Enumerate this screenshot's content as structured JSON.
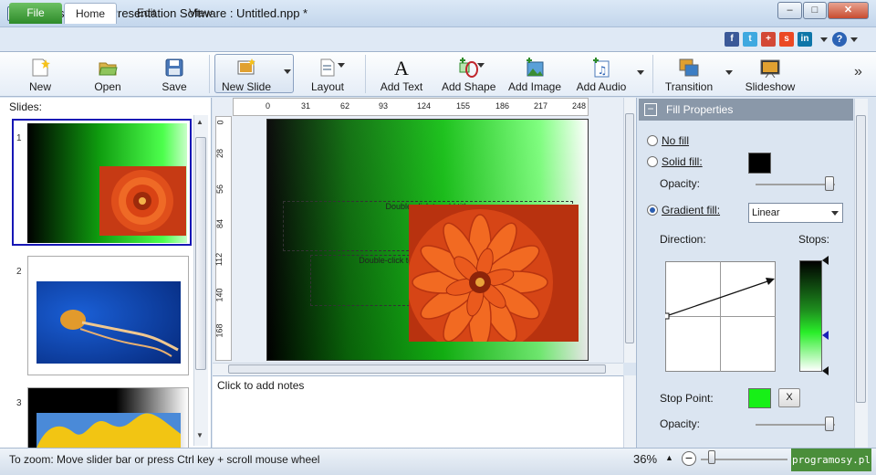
{
  "window": {
    "title": "Express Points Presentation Software : Untitled.npp *",
    "minimize": "–",
    "maximize": "□",
    "close": "✕"
  },
  "tabs": {
    "file": "File",
    "home": "Home",
    "edit": "Edit",
    "view": "View"
  },
  "toolbar": {
    "new": "New",
    "open": "Open",
    "save": "Save",
    "new_slide": "New Slide",
    "layout": "Layout",
    "add_text": "Add Text",
    "add_shape": "Add Shape",
    "add_image": "Add Image",
    "add_audio": "Add Audio",
    "transition": "Transition",
    "slideshow": "Slideshow",
    "more": "»"
  },
  "slides_panel": {
    "label": "Slides:",
    "slides": [
      {
        "num": "1"
      },
      {
        "num": "2"
      },
      {
        "num": "3"
      }
    ]
  },
  "ruler": {
    "h": [
      "0",
      "31",
      "62",
      "93",
      "124",
      "155",
      "186",
      "217",
      "248"
    ],
    "v": [
      "0",
      "28",
      "56",
      "84",
      "112",
      "140",
      "168"
    ]
  },
  "slide": {
    "placeholder1": "Double-click to add title",
    "placeholder2": "Double-click to add text"
  },
  "notes": {
    "placeholder": "Click to add notes"
  },
  "fill_properties": {
    "title": "Fill Properties",
    "collapse": "−",
    "no_fill": "No fill",
    "solid_fill": "Solid fill:",
    "opacity": "Opacity:",
    "gradient_fill": "Gradient fill:",
    "gradient_type": "Linear",
    "direction": "Direction:",
    "stops": "Stops:",
    "stop_point": "Stop Point:",
    "stop_remove": "X",
    "opacity2": "Opacity:",
    "selected": "gradient_fill",
    "solid_color": "#000000",
    "stop_color": "#17f017"
  },
  "status": {
    "text": "To zoom: Move slider bar or press Ctrl key + scroll mouse wheel",
    "zoom": "36%",
    "watermark": "programosy.pl"
  },
  "colors": {
    "accent": "#2e8b2a",
    "header": "#8a98a9"
  }
}
